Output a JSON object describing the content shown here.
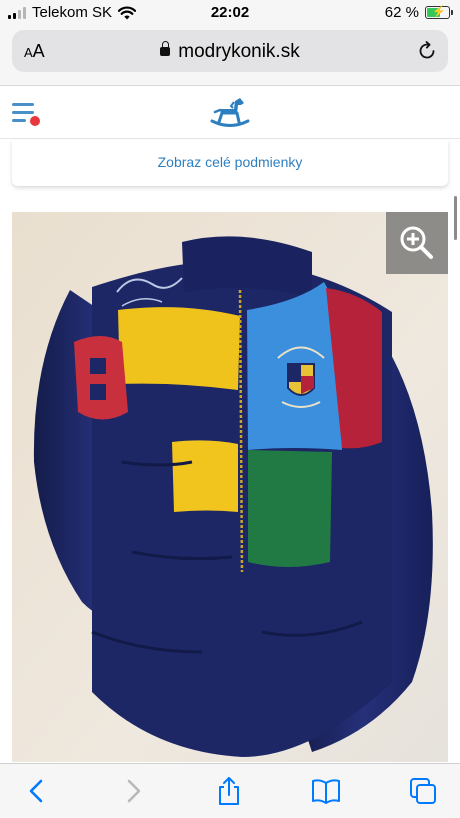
{
  "status_bar": {
    "carrier": "Telekom SK",
    "time": "22:02",
    "battery_percent": "62 %",
    "battery_level": 0.62
  },
  "browser": {
    "text_size_button": "AA",
    "url": "modrykonik.sk"
  },
  "page": {
    "conditions_link": "Zobraz celé podmienky"
  },
  "icons": {
    "wifi": "wifi-icon",
    "lock": "lock-icon",
    "reload": "reload-icon",
    "menu": "hamburger-menu-icon",
    "logo": "rocking-horse-logo",
    "zoom": "zoom-in-icon",
    "back": "back-icon",
    "forward": "forward-icon",
    "share": "share-icon",
    "bookmarks": "bookmarks-icon",
    "tabs": "tabs-icon"
  },
  "colors": {
    "accent": "#2e7fc0",
    "notification_dot": "#e8383d",
    "ios_blue": "#007aff"
  }
}
